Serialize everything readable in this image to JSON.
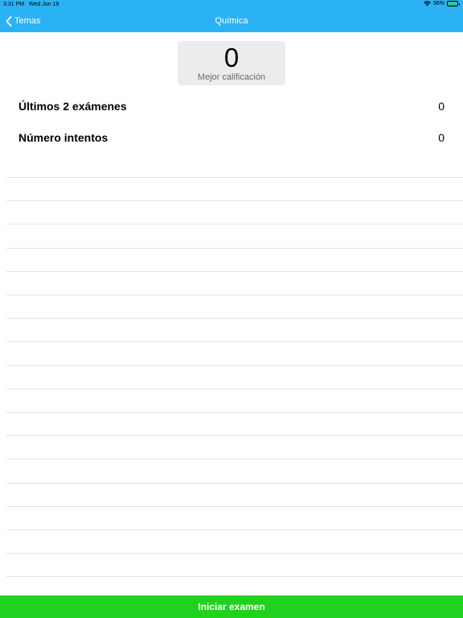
{
  "status_bar": {
    "time": "3:31 PM",
    "date": "Wed Jun 19",
    "battery": "96%",
    "battery_level": 0.96
  },
  "nav": {
    "back_label": "Temas",
    "title": "Química"
  },
  "score": {
    "value": "0",
    "label": "Mejor calificación"
  },
  "stats": [
    {
      "label": "Últimos 2 exámenes",
      "value": "0"
    },
    {
      "label": "Número intentos",
      "value": "0"
    }
  ],
  "empty_row_count": 18,
  "action": {
    "label": "Iniciar examen"
  },
  "colors": {
    "nav_bar": "#2bb2f5",
    "action_button": "#20d21f",
    "card_bg": "#ececef"
  },
  "icons": {
    "back": "chevron-left-icon",
    "wifi": "wifi-icon",
    "battery": "battery-icon"
  }
}
